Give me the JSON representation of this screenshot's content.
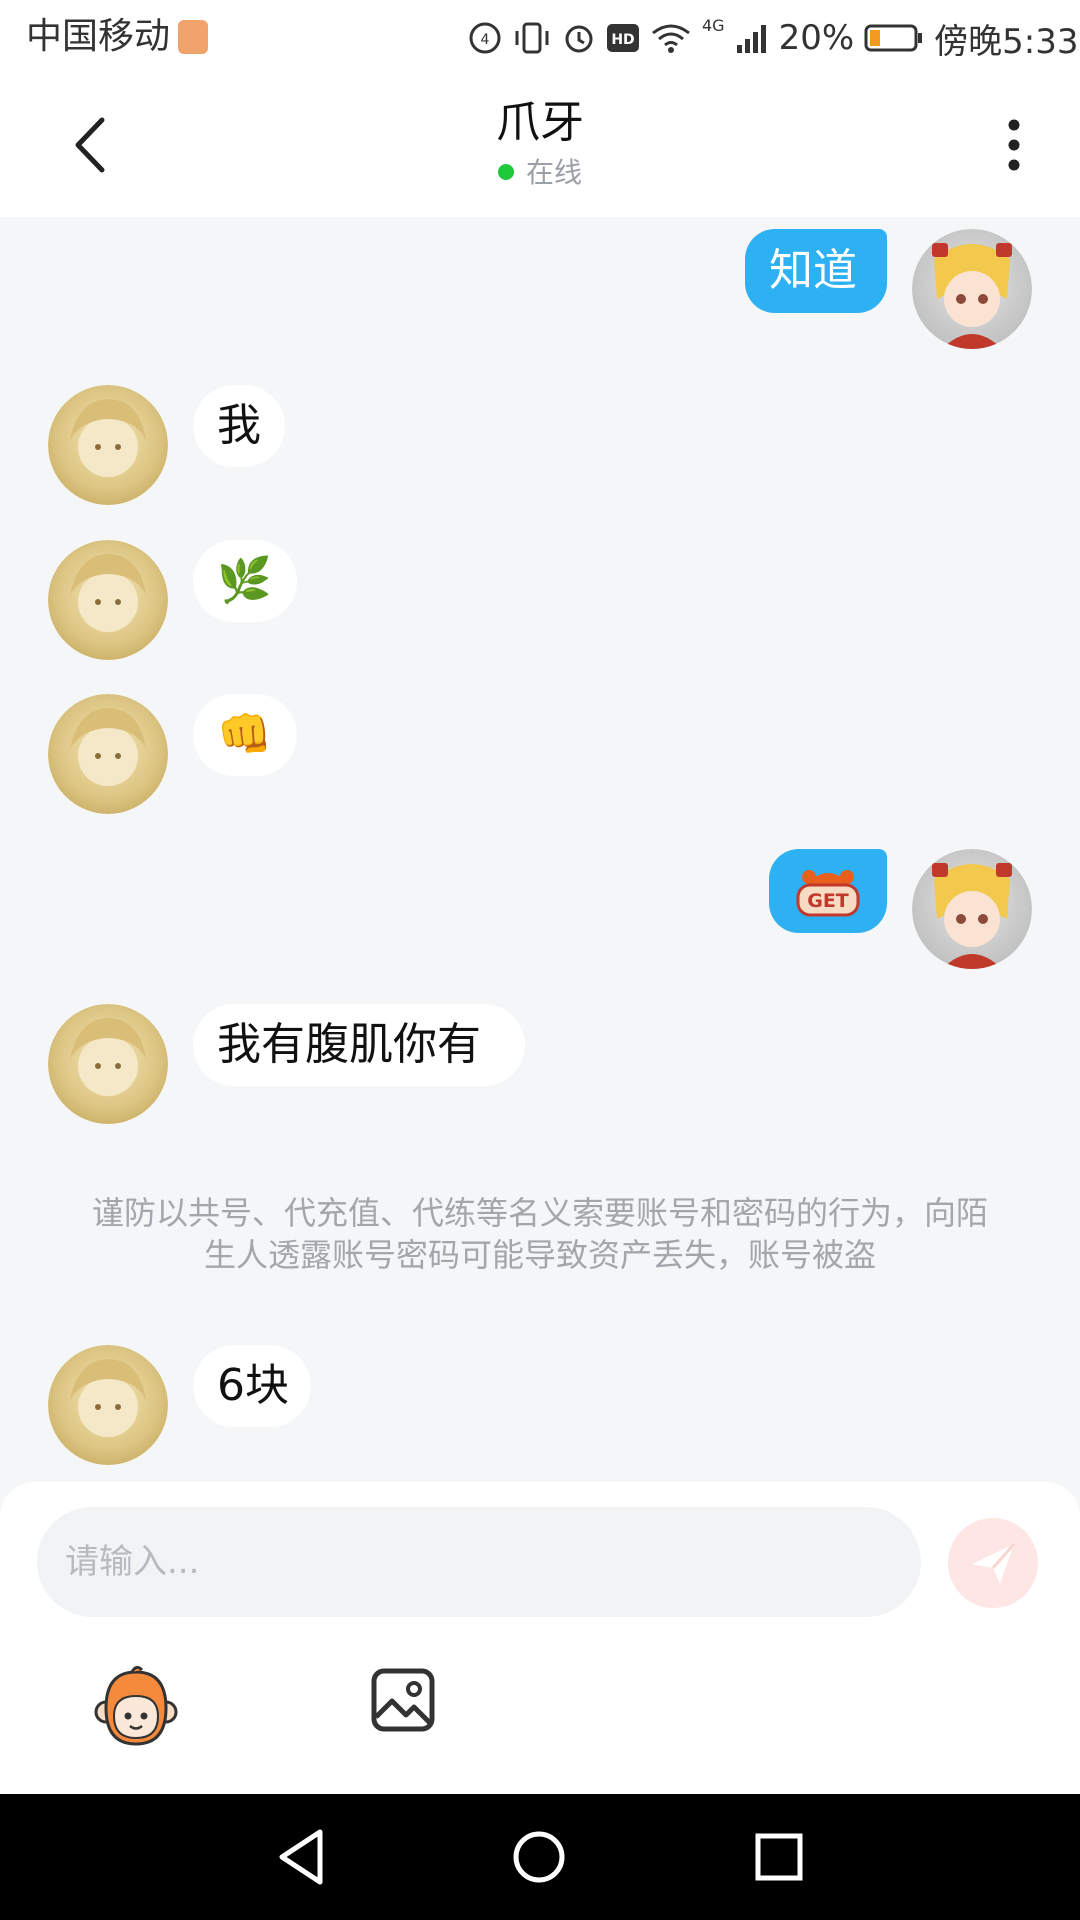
{
  "status_bar": {
    "carrier": "中国移动",
    "network": "4G",
    "battery": "20%",
    "time": "傍晚5:33"
  },
  "header": {
    "title": "爪牙",
    "status": "在线",
    "back_icon": "chevron-left-icon",
    "more_icon": "more-vertical-icon"
  },
  "messages": [
    {
      "direction": "out",
      "type": "text",
      "text": "知道"
    },
    {
      "direction": "in",
      "type": "text",
      "text": "我"
    },
    {
      "direction": "in",
      "type": "emoji",
      "text": "🌿"
    },
    {
      "direction": "in",
      "type": "emoji",
      "text": "👊"
    },
    {
      "direction": "out",
      "type": "sticker",
      "text": "GET"
    },
    {
      "direction": "in",
      "type": "text",
      "text": "我有腹肌你有"
    },
    {
      "direction": "in",
      "type": "text",
      "text": "6块"
    }
  ],
  "notice": "谨防以共号、代充值、代练等名义索要账号和密码的行为，向陌生人透露账号密码可能导致资产丢失，账号被盗",
  "input": {
    "placeholder": "请输入...",
    "value": ""
  },
  "colors": {
    "outgoing_bubble": "#2eb1f3",
    "incoming_bubble": "#ffffff",
    "online_dot": "#1fc93a",
    "send_button": "#fde6e4",
    "background": "#f4f6f8"
  }
}
